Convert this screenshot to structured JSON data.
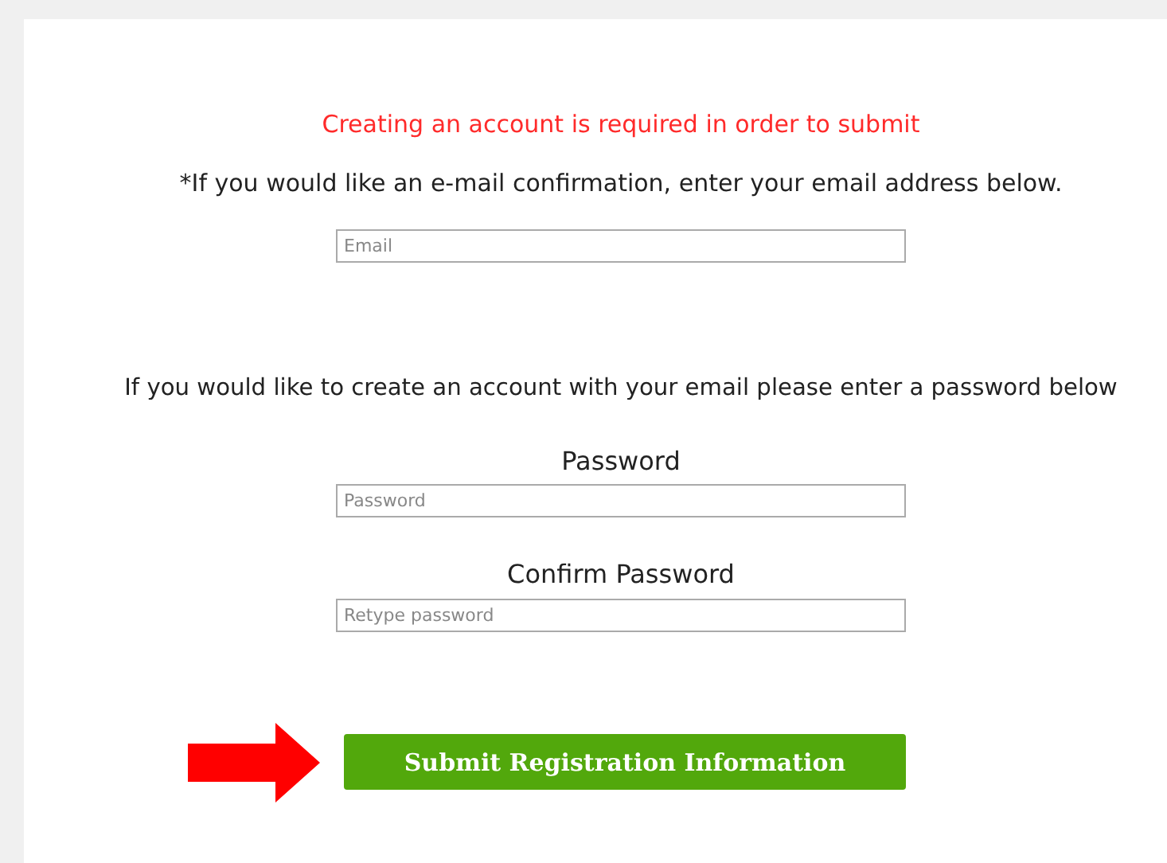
{
  "notice": "Creating an account is required in order to submit",
  "email_hint": "*If you would like an e-mail confirmation, enter your email address below.",
  "email": {
    "placeholder": "Email"
  },
  "account_hint": "If you would like to create an account with your email please enter a password below",
  "password": {
    "label": "Password",
    "placeholder": "Password"
  },
  "confirm_password": {
    "label": "Confirm Password",
    "placeholder": "Retype password"
  },
  "submit_button": "Submit Registration Information"
}
